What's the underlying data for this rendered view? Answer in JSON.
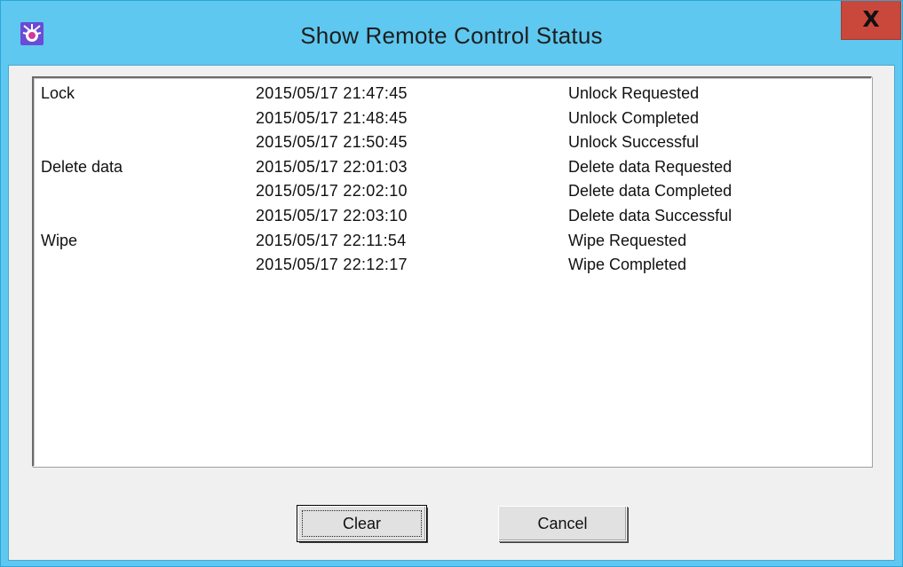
{
  "window": {
    "title": "Show Remote Control Status",
    "close_label": "X",
    "app_icon": "remote-control-app-icon",
    "colors": {
      "titlebar": "#5ec8f0",
      "close_button": "#c9483b",
      "client_background": "#f0f0f0",
      "list_background": "#ffffff"
    }
  },
  "status_list": {
    "rows": [
      {
        "action": "Lock",
        "time": "2015/05/17 21:47:45",
        "status": "Unlock Requested"
      },
      {
        "action": "",
        "time": "2015/05/17 21:48:45",
        "status": "Unlock Completed"
      },
      {
        "action": "",
        "time": "2015/05/17 21:50:45",
        "status": "Unlock Successful"
      },
      {
        "action": "Delete data",
        "time": "2015/05/17 22:01:03",
        "status": "Delete data Requested"
      },
      {
        "action": "",
        "time": "2015/05/17 22:02:10",
        "status": "Delete data Completed"
      },
      {
        "action": "",
        "time": "2015/05/17 22:03:10",
        "status": "Delete data Successful"
      },
      {
        "action": "Wipe",
        "time": "2015/05/17 22:11:54",
        "status": "Wipe Requested"
      },
      {
        "action": "",
        "time": "2015/05/17 22:12:17",
        "status": "Wipe Completed"
      }
    ]
  },
  "buttons": {
    "clear_label": "Clear",
    "cancel_label": "Cancel"
  }
}
